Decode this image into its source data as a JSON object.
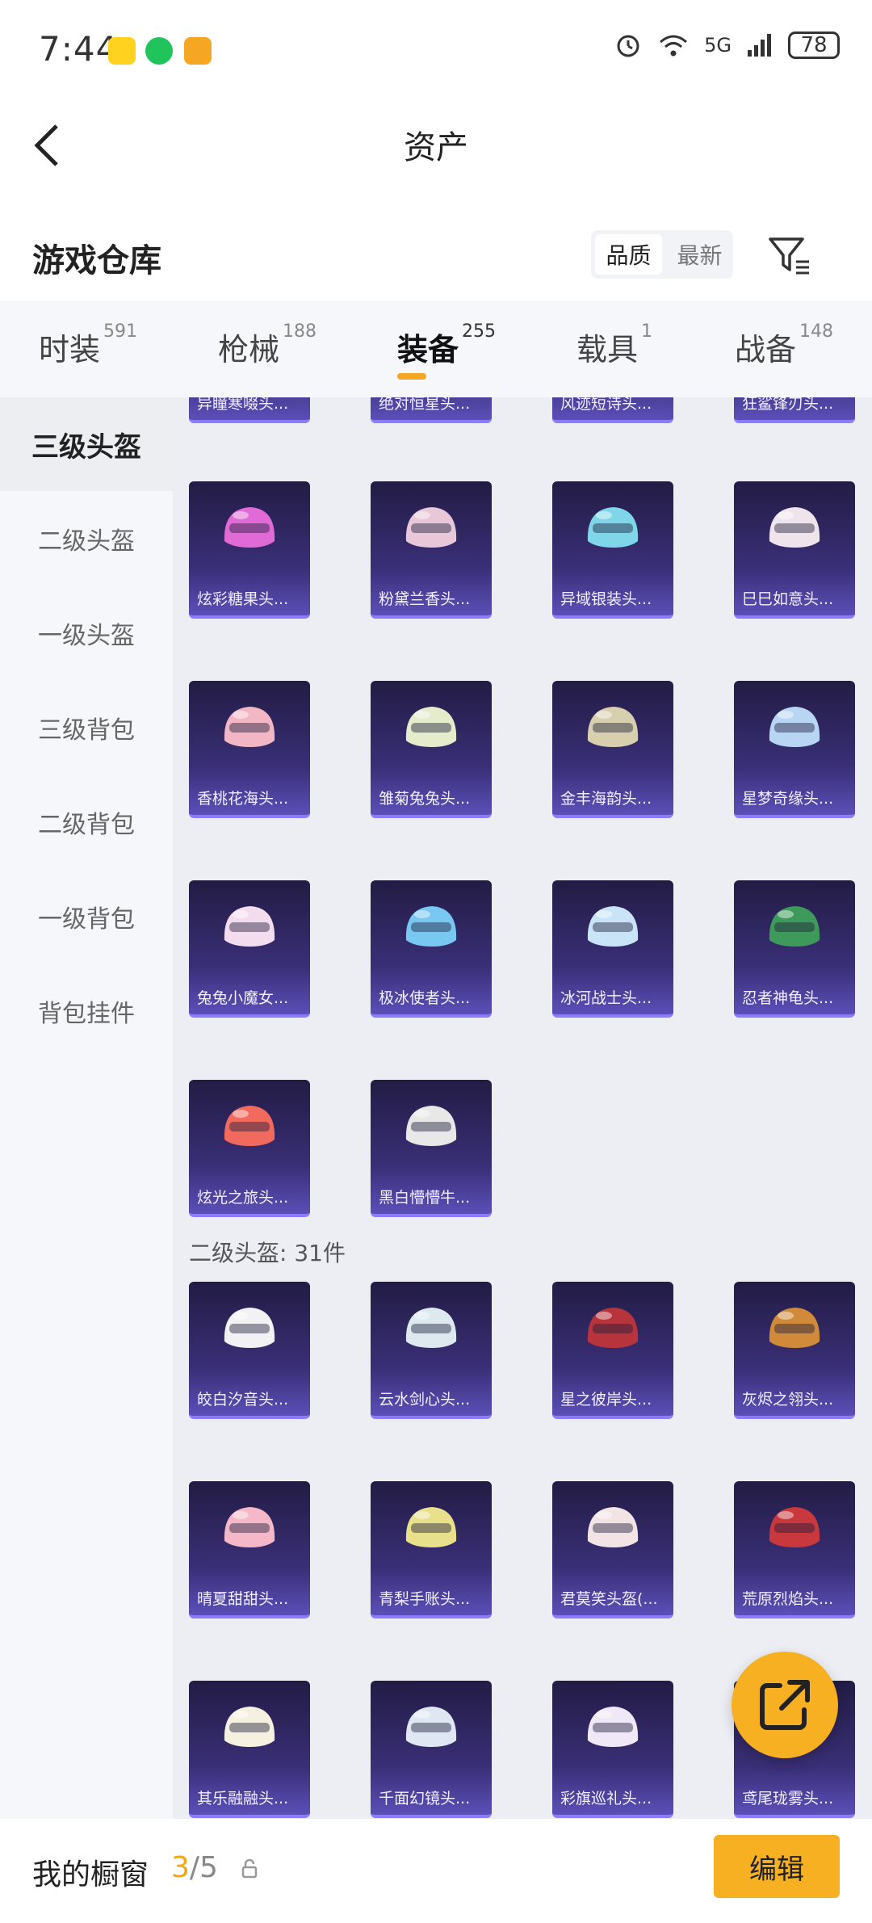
{
  "status_bar": {
    "time": "7:44",
    "app_icons": [
      "meituan-icon",
      "wechat-icon",
      "cup-icon"
    ],
    "network": "5G",
    "battery": "78"
  },
  "header": {
    "title": "资产",
    "back_icon": "chevron-left-icon"
  },
  "warehouse": {
    "title": "游戏仓库",
    "sort_options": [
      "品质",
      "最新"
    ],
    "sort_selected": "品质",
    "filter_icon": "filter-icon"
  },
  "tabs": [
    {
      "label": "时装",
      "count": "591",
      "active": false
    },
    {
      "label": "枪械",
      "count": "188",
      "active": false
    },
    {
      "label": "装备",
      "count": "255",
      "active": true
    },
    {
      "label": "载具",
      "count": "1",
      "active": false
    },
    {
      "label": "战备",
      "count": "148",
      "active": false
    }
  ],
  "sidebar": [
    {
      "label": "三级头盔",
      "active": true
    },
    {
      "label": "二级头盔",
      "active": false
    },
    {
      "label": "一级头盔",
      "active": false
    },
    {
      "label": "三级背包",
      "active": false
    },
    {
      "label": "二级背包",
      "active": false
    },
    {
      "label": "一级背包",
      "active": false
    },
    {
      "label": "背包挂件",
      "active": false
    }
  ],
  "partial_row": [
    "异瞳寒啜头...",
    "绝对恒星头...",
    "风迹短诗头...",
    "狂鲨锋刃头..."
  ],
  "level3_items": [
    {
      "name": "炫彩糖果头...",
      "color": "#e06ad6"
    },
    {
      "name": "粉黛兰香头...",
      "color": "#e8c8d8"
    },
    {
      "name": "异域银装头...",
      "color": "#7fd6e8"
    },
    {
      "name": "巳巳如意头...",
      "color": "#f0e4ec"
    },
    {
      "name": "香桃花海头...",
      "color": "#f2b6c4"
    },
    {
      "name": "雏菊兔兔头...",
      "color": "#e4eccc"
    },
    {
      "name": "金丰海韵头...",
      "color": "#d8cfae"
    },
    {
      "name": "星梦奇缘头...",
      "color": "#b8d6f4"
    },
    {
      "name": "兔兔小魔女...",
      "color": "#f4dcef"
    },
    {
      "name": "极冰使者头...",
      "color": "#78c8f2"
    },
    {
      "name": "冰河战士头...",
      "color": "#c8e4f6"
    },
    {
      "name": "忍者神龟头...",
      "color": "#3e9a5a"
    },
    {
      "name": "炫光之旅头...",
      "color": "#f26a5e"
    },
    {
      "name": "黑白懵懵牛...",
      "color": "#e8e8e8"
    }
  ],
  "section_level2": "二级头盔: 31件",
  "level2_items": [
    {
      "name": "皎白汐音头...",
      "color": "#f2f2f4"
    },
    {
      "name": "云水剑心头...",
      "color": "#dde9ef"
    },
    {
      "name": "星之彼岸头...",
      "color": "#b8343c"
    },
    {
      "name": "灰烬之翎头...",
      "color": "#d08a3a"
    },
    {
      "name": "晴夏甜甜头...",
      "color": "#f4b8c8"
    },
    {
      "name": "青梨手账头...",
      "color": "#e8e08a"
    },
    {
      "name": "君莫笑头盔(...",
      "color": "#f2e4e4"
    },
    {
      "name": "荒原烈焰头...",
      "color": "#c8383c"
    },
    {
      "name": "其乐融融头...",
      "color": "#f6f0e0"
    },
    {
      "name": "千面幻镜头...",
      "color": "#dfe8f2"
    },
    {
      "name": "彩旗巡礼头...",
      "color": "#f0e8f6"
    },
    {
      "name": "鸢尾珑雾头...",
      "color": "#c8a8e8"
    }
  ],
  "fab_icon": "share-external-icon",
  "bottom": {
    "label": "我的橱窗",
    "count_current": "3",
    "count_total": "/5",
    "lock_icon": "lock-icon",
    "edit_label": "编辑"
  }
}
